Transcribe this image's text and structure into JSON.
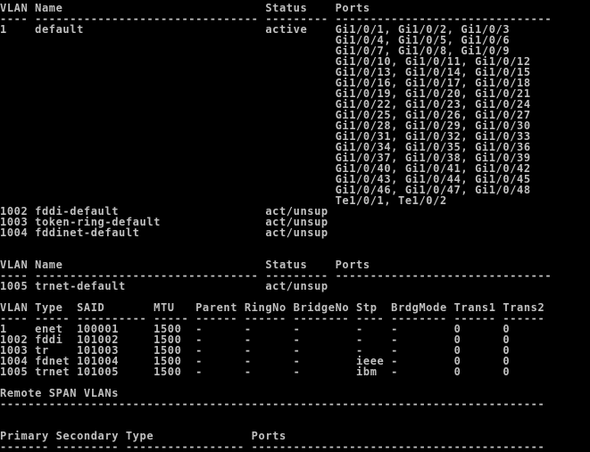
{
  "terminal": {
    "background": "#000000",
    "foreground": "#c0c0c0",
    "lines": [
      "VLAN Name                             Status    Ports",
      "---- -------------------------------- --------- -------------------------------",
      "1    default                          active    Gi1/0/1, Gi1/0/2, Gi1/0/3",
      "                                                Gi1/0/4, Gi1/0/5, Gi1/0/6",
      "                                                Gi1/0/7, Gi1/0/8, Gi1/0/9",
      "                                                Gi1/0/10, Gi1/0/11, Gi1/0/12",
      "                                                Gi1/0/13, Gi1/0/14, Gi1/0/15",
      "                                                Gi1/0/16, Gi1/0/17, Gi1/0/18",
      "                                                Gi1/0/19, Gi1/0/20, Gi1/0/21",
      "                                                Gi1/0/22, Gi1/0/23, Gi1/0/24",
      "                                                Gi1/0/25, Gi1/0/26, Gi1/0/27",
      "                                                Gi1/0/28, Gi1/0/29, Gi1/0/30",
      "                                                Gi1/0/31, Gi1/0/32, Gi1/0/33",
      "                                                Gi1/0/34, Gi1/0/35, Gi1/0/36",
      "                                                Gi1/0/37, Gi1/0/38, Gi1/0/39",
      "                                                Gi1/0/40, Gi1/0/41, Gi1/0/42",
      "                                                Gi1/0/43, Gi1/0/44, Gi1/0/45",
      "                                                Gi1/0/46, Gi1/0/47, Gi1/0/48",
      "                                                Te1/0/1, Te1/0/2",
      "1002 fddi-default                     act/unsup",
      "1003 token-ring-default               act/unsup",
      "1004 fddinet-default                  act/unsup",
      "",
      "",
      "VLAN Name                             Status    Ports",
      "---- -------------------------------- --------- -------------------------------",
      "1005 trnet-default                    act/unsup",
      "",
      "VLAN Type  SAID       MTU   Parent RingNo BridgeNo Stp  BrdgMode Trans1 Trans2",
      "---- ----- ---------- ----- ------ ------ -------- ---- -------- ------ ------",
      "1    enet  100001     1500  -      -      -        -    -        0      0",
      "1002 fddi  101002     1500  -      -      -        -    -        0      0",
      "1003 tr    101003     1500  -      -      -        -    -        0      0",
      "1004 fdnet 101004     1500  -      -      -        ieee -        0      0",
      "1005 trnet 101005     1500  -      -      -        ibm  -        0      0",
      "",
      "Remote SPAN VLANs",
      "------------------------------------------------------------------------------",
      "",
      "",
      "Primary Secondary Type              Ports",
      "------- --------- ----------------- ------------------------------------------"
    ]
  }
}
